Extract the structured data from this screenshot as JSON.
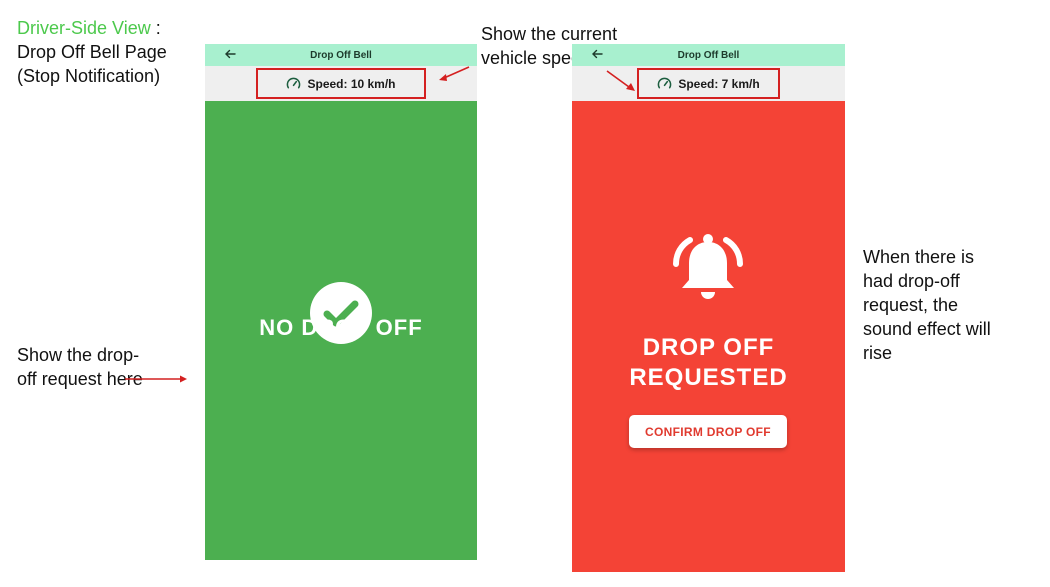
{
  "annotations": {
    "title_accent": "Driver-Side View",
    "title_colon": " :",
    "title_line2": "Drop Off Bell Page",
    "title_line3": "(Stop Notification)",
    "speed_note": "Show the current vehicle speed",
    "request_note": "Show the drop-off request here",
    "sound_note": "When there is had drop-off request, the sound effect will rise"
  },
  "left_screen": {
    "title": "Drop Off Bell",
    "speed": "Speed: 10 km/h",
    "status": "NO DROP OFF"
  },
  "right_screen": {
    "title": "Drop Off Bell",
    "speed": "Speed: 7 km/h",
    "status_line1": "DROP OFF",
    "status_line2": "REQUESTED",
    "confirm_label": "CONFIRM DROP OFF"
  },
  "colors": {
    "accent_green": "#4cc94c",
    "titlebar": "#a8f0cf",
    "no_drop_bg": "#4caf50",
    "requested_bg": "#f44336",
    "highlight_red": "#d42020"
  },
  "icons": [
    "back-arrow-icon",
    "speedometer-icon",
    "checkmark-icon",
    "bell-ringing-icon"
  ]
}
